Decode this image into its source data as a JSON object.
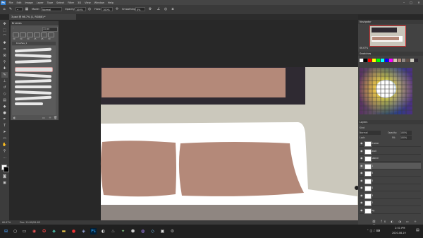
{
  "menu": {
    "app_icon": "Ps",
    "items": [
      "File",
      "Edit",
      "Image",
      "Layer",
      "Type",
      "Select",
      "Filter",
      "3D",
      "View",
      "Window",
      "Help"
    ]
  },
  "options": {
    "mode_label": "Mode:",
    "mode_value": "Normal",
    "opacity_label": "Opacity:",
    "opacity_value": "100%",
    "flow_label": "Flow:",
    "flow_value": "100%",
    "smoothing_label": "Smoothing:",
    "smoothing_value": "0%"
  },
  "document": {
    "tab_title": "3.psd @ 66.7% (1, RGB/8) *"
  },
  "brushes_panel": {
    "title": "Brushes",
    "size_value": "11 px",
    "folder": "brushes_1",
    "preset_sizes": [
      "30",
      "30",
      "30",
      "25",
      "25",
      "30"
    ]
  },
  "right": {
    "navigator_title": "Navigator",
    "navigator_zoom": "66.67%",
    "swatches_title": "Swatches",
    "layers_title": "Layers",
    "kind_label": "Kind",
    "blend_value": "Normal",
    "opacity_label": "Opacity:",
    "opacity_value": "100%",
    "lock_label": "Lock:",
    "fill_label": "Fill:",
    "fill_value": "100%",
    "layers": [
      {
        "name": "frame",
        "selected": false
      },
      {
        "name": "wall",
        "selected": false
      },
      {
        "name": "stand",
        "selected": false
      },
      {
        "name": "1",
        "selected": true
      },
      {
        "name": "6",
        "selected": false
      },
      {
        "name": "5",
        "selected": false
      },
      {
        "name": "4",
        "selected": false
      },
      {
        "name": "3",
        "selected": false
      },
      {
        "name": "2",
        "selected": false
      },
      {
        "name": "bg",
        "selected": false
      }
    ]
  },
  "status": {
    "zoom": "66.67%",
    "doc_info": "Doc: 10.0M/84.4M"
  },
  "taskbar": {
    "time": "2:51 PM",
    "date": "2020-08-19"
  },
  "colors": {
    "pillow": "#b48979",
    "frame": "#2f2a32",
    "wall": "#cbc8bc",
    "sofa": "#ffffff",
    "floor": "#8f8681"
  }
}
